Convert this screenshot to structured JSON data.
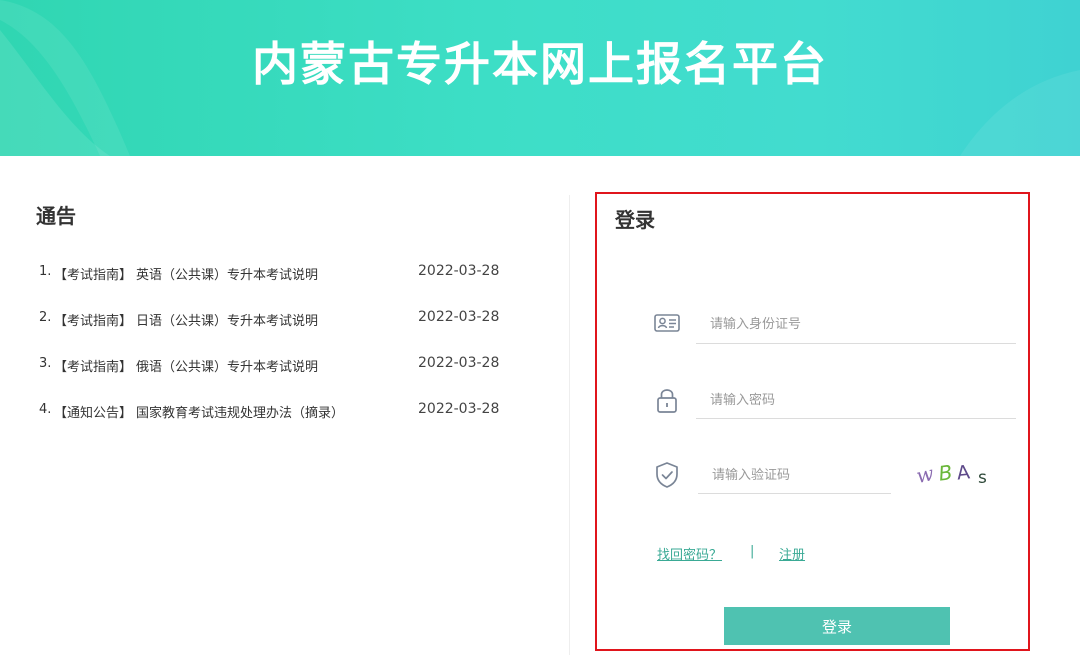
{
  "header": {
    "title": "内蒙古专升本网上报名平台"
  },
  "notice": {
    "title": "通告",
    "items": [
      {
        "index": "1.",
        "category": "【考试指南】",
        "title": "英语（公共课）专升本考试说明",
        "date": "2022-03-28"
      },
      {
        "index": "2.",
        "category": "【考试指南】",
        "title": "日语（公共课）专升本考试说明",
        "date": "2022-03-28"
      },
      {
        "index": "3.",
        "category": "【考试指南】",
        "title": "俄语（公共课）专升本考试说明",
        "date": "2022-03-28"
      },
      {
        "index": "4.",
        "category": "【通知公告】",
        "title": "国家教育考试违规处理办法（摘录）",
        "date": "2022-03-28"
      }
    ]
  },
  "login": {
    "title": "登录",
    "id_field": {
      "placeholder": "请输入身份证号",
      "value": "",
      "icon": "id-card-icon"
    },
    "password_field": {
      "placeholder": "请输入密码",
      "value": "",
      "icon": "lock-icon"
    },
    "captcha_field": {
      "placeholder": "请输入验证码",
      "value": "",
      "icon": "shield-check-icon"
    },
    "captcha_text": "wBAs",
    "forgot_label": "找回密码？",
    "separator": "|",
    "register_label": "注册",
    "submit_label": "登录"
  },
  "colors": {
    "banner_start": "#30d6b2",
    "banner_end": "#3fd2d2",
    "accent": "#4fc2b1",
    "link": "#3aaa95",
    "highlight_border": "#e0151c"
  }
}
